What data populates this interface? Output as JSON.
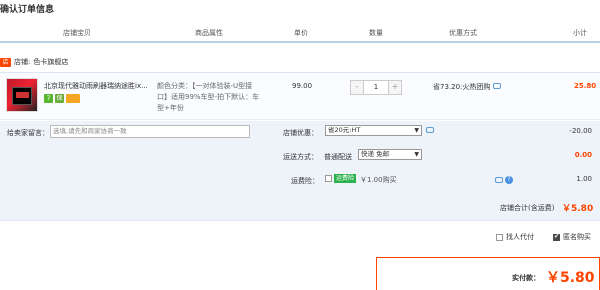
{
  "page_title": "确认订单信息",
  "columns": {
    "shop_item": "店铺宝贝",
    "attributes": "商品属性",
    "unit_price": "单价",
    "quantity": "数量",
    "discount": "优惠方式",
    "subtotal": "小计"
  },
  "shop": {
    "icon_text": "店",
    "label": "店铺:",
    "name": "色卡旗舰店"
  },
  "item": {
    "title": "北京现代雅动雨刷器瑞纳途胜ix...",
    "attr_line1": "颜色分类：【一对体验装-U型接",
    "attr_line2": "口】适用99%车型-拍下默认：车",
    "attr_line3": "型+年份",
    "unit_price": "99.00",
    "quantity": "1",
    "promo": "省73.20:火热团购",
    "subtotal": "25.80",
    "badge_7": "7",
    "badge_green": "保"
  },
  "message": {
    "label": "给卖家留言：",
    "placeholder": "选填,请先和商家协商一致"
  },
  "shop_discount": {
    "label": "店铺优惠：",
    "selected": "省20元:HT",
    "value": "-20.00"
  },
  "shipping": {
    "label": "运送方式：",
    "type": "普通配送",
    "selected": "快递 免邮",
    "value": "0.00"
  },
  "insurance": {
    "label": "运费险：",
    "tag": "运费险",
    "price": "￥1.00购买",
    "value": "1.00"
  },
  "shop_total": {
    "label": "店铺合计(含运费)",
    "value": "￥5.80"
  },
  "options": {
    "anonymous": "匿名购买",
    "proxy_pay": "找人代付"
  },
  "payment": {
    "label": "实付款：",
    "value": "￥5.80"
  },
  "colors": {
    "accent": "#ff4400",
    "header_line": "#b9d0e6",
    "panel_bg": "#eef3fa"
  }
}
